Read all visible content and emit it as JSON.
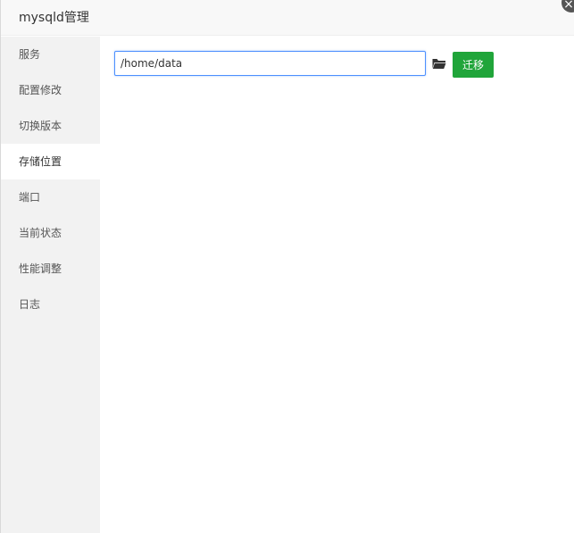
{
  "dialog": {
    "title": "mysqld管理",
    "close_symbol": "×"
  },
  "sidebar": {
    "items": [
      {
        "label": "服务"
      },
      {
        "label": "配置修改"
      },
      {
        "label": "切换版本"
      },
      {
        "label": "存储位置"
      },
      {
        "label": "端口"
      },
      {
        "label": "当前状态"
      },
      {
        "label": "性能调整"
      },
      {
        "label": "日志"
      }
    ],
    "active_index": 3
  },
  "storage": {
    "path_value": "/home/data",
    "migrate_label": "迁移",
    "icon": "folder-open-icon"
  },
  "colors": {
    "accent_green": "#20a53a",
    "input_focus_border": "#4d90fe",
    "sidebar_bg": "#f2f2f2"
  }
}
